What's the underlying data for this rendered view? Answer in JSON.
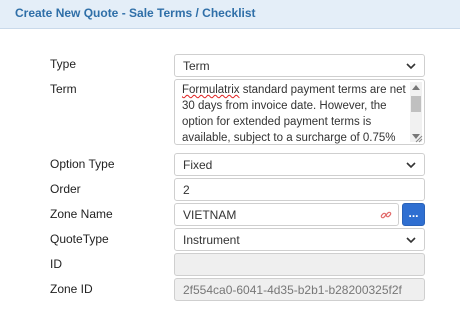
{
  "header": {
    "title": "Create New Quote - Sale Terms / Checklist"
  },
  "form": {
    "type": {
      "label": "Type",
      "value": "Term"
    },
    "term": {
      "label": "Term",
      "first_word": "Formulatrix",
      "value_rest": " standard payment terms are net 30 days from invoice date. However, the option for extended payment terms is available, subject to a surcharge of 0.75%"
    },
    "option_type": {
      "label": "Option Type",
      "value": "Fixed"
    },
    "order": {
      "label": "Order",
      "value": "2"
    },
    "zone_name": {
      "label": "Zone Name",
      "value": "VIETNAM",
      "button_label": "..."
    },
    "quote_type": {
      "label": "QuoteType",
      "value": "Instrument"
    },
    "id": {
      "label": "ID",
      "value": ""
    },
    "zone_id": {
      "label": "Zone ID",
      "value": "2f554ca0-6041-4d35-b2b1-b28200325f2f"
    }
  },
  "icons": {
    "select_arrow": "chevron-down-icon",
    "link": "link-icon"
  },
  "colors": {
    "header_bg": "#e4eef8",
    "header_text": "#2f6fa8",
    "button_bg": "#2f6fd1",
    "link_icon": "#e26a6a"
  }
}
